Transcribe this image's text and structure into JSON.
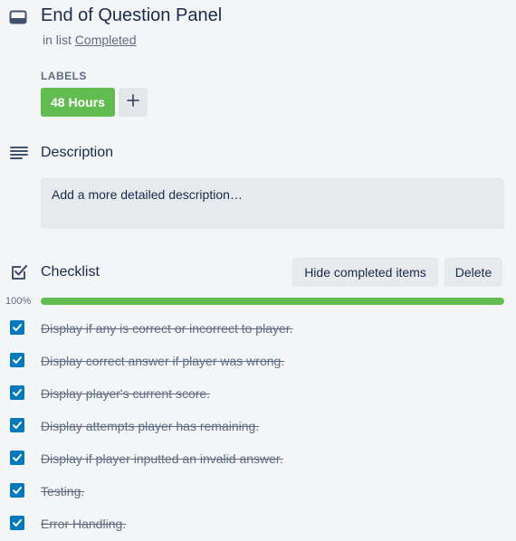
{
  "card": {
    "title": "End of Question Panel",
    "in_list_prefix": "in list",
    "list_name": "Completed"
  },
  "labels": {
    "heading": "LABELS",
    "items": [
      {
        "text": "48 Hours",
        "color": "#61bd4f"
      }
    ],
    "add_symbol": "+"
  },
  "description": {
    "heading": "Description",
    "placeholder": "Add a more detailed description…"
  },
  "checklist": {
    "heading": "Checklist",
    "hide_button": "Hide completed items",
    "delete_button": "Delete",
    "progress_label": "100%",
    "progress": 1.0,
    "items": [
      {
        "text": "Display if any is correct or incorrect to player.",
        "checked": true
      },
      {
        "text": "Display correct answer if player was wrong.",
        "checked": true
      },
      {
        "text": "Display player's current score.",
        "checked": true
      },
      {
        "text": "Display attempts player has remaining.",
        "checked": true
      },
      {
        "text": "Display if player inputted an invalid answer.",
        "checked": true
      },
      {
        "text": "Testing.",
        "checked": true
      },
      {
        "text": "Error Handling.",
        "checked": true
      }
    ]
  },
  "colors": {
    "accent_green": "#61bd4f",
    "checkbox_blue": "#0079bf",
    "text_dark": "#172b4d",
    "text_muted": "#5e6c84"
  },
  "icons": {
    "card": "card-icon",
    "description": "description-lines-icon",
    "checklist": "checklist-icon",
    "checkbox": "checkmark-icon",
    "add": "plus-icon"
  }
}
